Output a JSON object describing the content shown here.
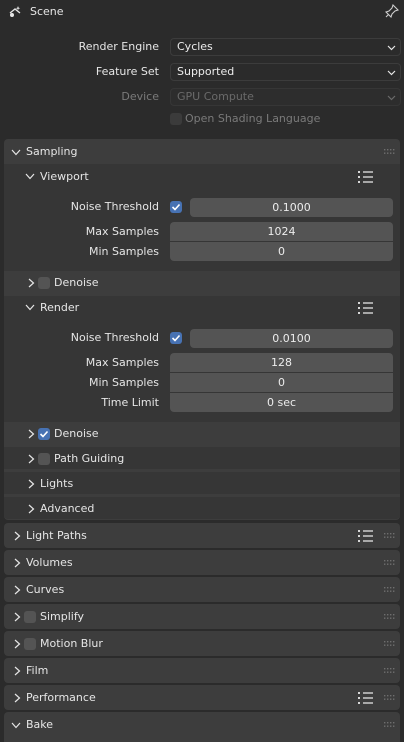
{
  "header": {
    "title": "Scene"
  },
  "properties": {
    "render_engine": {
      "label": "Render Engine",
      "value": "Cycles"
    },
    "feature_set": {
      "label": "Feature Set",
      "value": "Supported"
    },
    "device": {
      "label": "Device",
      "value": "GPU Compute"
    },
    "osl": {
      "label": "Open Shading Language"
    }
  },
  "sampling": {
    "title": "Sampling",
    "viewport": {
      "title": "Viewport",
      "noise_threshold": {
        "label": "Noise Threshold",
        "value": "0.1000"
      },
      "max_samples": {
        "label": "Max Samples",
        "value": "1024"
      },
      "min_samples": {
        "label": "Min Samples",
        "value": "0"
      },
      "denoise": "Denoise"
    },
    "render": {
      "title": "Render",
      "noise_threshold": {
        "label": "Noise Threshold",
        "value": "0.0100"
      },
      "max_samples": {
        "label": "Max Samples",
        "value": "128"
      },
      "min_samples": {
        "label": "Min Samples",
        "value": "0"
      },
      "time_limit": {
        "label": "Time Limit",
        "value": "0 sec"
      },
      "denoise": "Denoise"
    },
    "path_guiding": "Path Guiding",
    "lights": "Lights",
    "advanced": "Advanced"
  },
  "panels": {
    "light_paths": "Light Paths",
    "volumes": "Volumes",
    "curves": "Curves",
    "simplify": "Simplify",
    "motion_blur": "Motion Blur",
    "film": "Film",
    "performance": "Performance",
    "bake": "Bake"
  },
  "colors": {
    "background": "#2b2b2b",
    "panel": "#3d3d3d",
    "field": "#545454",
    "accent": "#4772b3"
  },
  "icons": [
    "scene-icon",
    "pin-icon",
    "chevron-down-icon",
    "chevron-right-icon",
    "list-icon",
    "drag-grip-icon",
    "checkbox-icon"
  ]
}
